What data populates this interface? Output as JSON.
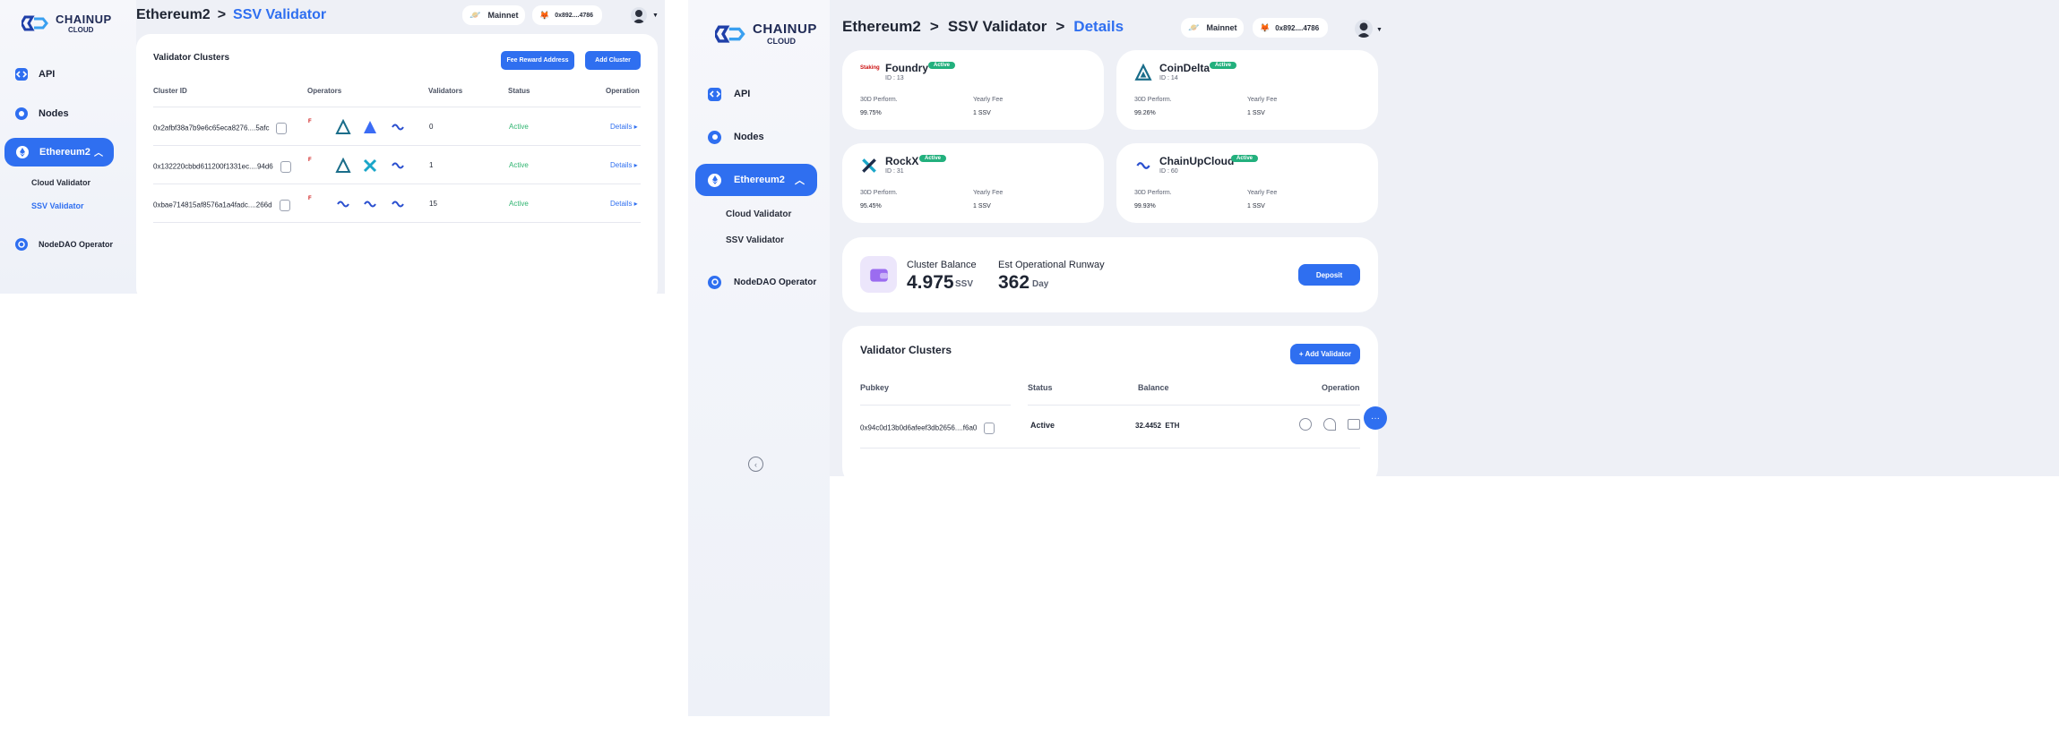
{
  "colors": {
    "accent": "#2f6ff0",
    "active_status": "#2fb470",
    "badge": "#22b07d"
  },
  "brand": {
    "name": "CHAINUP",
    "sub": "CLOUD"
  },
  "left": {
    "sidebar": {
      "items": [
        {
          "label": "API",
          "icon": "api-icon"
        },
        {
          "label": "Nodes",
          "icon": "nodes-icon"
        },
        {
          "label": "Ethereum2",
          "icon": "ethereum-icon"
        },
        {
          "label": "NodeDAO Operator",
          "icon": "nodedao-icon"
        }
      ],
      "sub_items": [
        "Cloud Validator",
        "SSV Validator"
      ]
    },
    "breadcrumb": {
      "root": "Ethereum2",
      "sep": ">",
      "current": "SSV Validator"
    },
    "network": "Mainnet",
    "wallet": "0x892....4786",
    "section_title": "Validator Clusters",
    "buttons": {
      "fee": "Fee Reward Address",
      "add": "Add Cluster"
    },
    "table": {
      "headers": [
        "Cluster ID",
        "Operators",
        "Validators",
        "Status",
        "Operation"
      ],
      "rows": [
        {
          "id": "0x2afbf38a7b9e6c65eca8276....5afc",
          "validators": "0",
          "status": "Active",
          "op": "Details"
        },
        {
          "id": "0x132220cbbd611200f1331ec....94d6",
          "validators": "1",
          "status": "Active",
          "op": "Details"
        },
        {
          "id": "0xbae714815af8576a1a4fadc....266d",
          "validators": "15",
          "status": "Active",
          "op": "Details"
        }
      ]
    }
  },
  "right": {
    "sidebar": {
      "items": [
        {
          "label": "API",
          "icon": "api-icon"
        },
        {
          "label": "Nodes",
          "icon": "nodes-icon"
        },
        {
          "label": "Ethereum2",
          "icon": "ethereum-icon"
        },
        {
          "label": "NodeDAO Operator",
          "icon": "nodedao-icon"
        }
      ],
      "sub_items": [
        "Cloud Validator",
        "SSV Validator"
      ]
    },
    "breadcrumb": {
      "root": "Ethereum2",
      "mid": "SSV Validator",
      "sep": ">",
      "current": "Details"
    },
    "network": "Mainnet",
    "wallet": "0x892....4786",
    "operators": [
      {
        "name": "Foundry",
        "badge": "Active",
        "id": "ID : 13",
        "perf_label": "30D Perform.",
        "perf": "99.75%",
        "fee_label": "Yearly Fee",
        "fee": "1 SSV",
        "logo_text": "Staking"
      },
      {
        "name": "CoinDelta",
        "badge": "Active",
        "id": "ID : 14",
        "perf_label": "30D Perform.",
        "perf": "99.26%",
        "fee_label": "Yearly Fee",
        "fee": "1 SSV"
      },
      {
        "name": "RockX",
        "badge": "Active",
        "id": "ID : 31",
        "perf_label": "30D Perform.",
        "perf": "95.45%",
        "fee_label": "Yearly Fee",
        "fee": "1 SSV"
      },
      {
        "name": "ChainUpCloud",
        "badge": "Active",
        "id": "ID : 60",
        "perf_label": "30D Perform.",
        "perf": "99.93%",
        "fee_label": "Yearly Fee",
        "fee": "1 SSV"
      }
    ],
    "balance": {
      "label": "Cluster Balance",
      "value": "4.975",
      "unit": "SSV",
      "runway_label": "Est Operational Runway",
      "runway_value": "362",
      "runway_unit": "Day",
      "deposit": "Deposit"
    },
    "clusters": {
      "title": "Validator Clusters",
      "add": "+ Add Validator",
      "headers": [
        "Pubkey",
        "Status",
        "Balance",
        "Operation"
      ],
      "row": {
        "pubkey": "0x94c0d13b0d6afeef3db2656....f6a0",
        "status": "Active",
        "balance": "32.4452",
        "balance_unit": "ETH"
      }
    }
  }
}
